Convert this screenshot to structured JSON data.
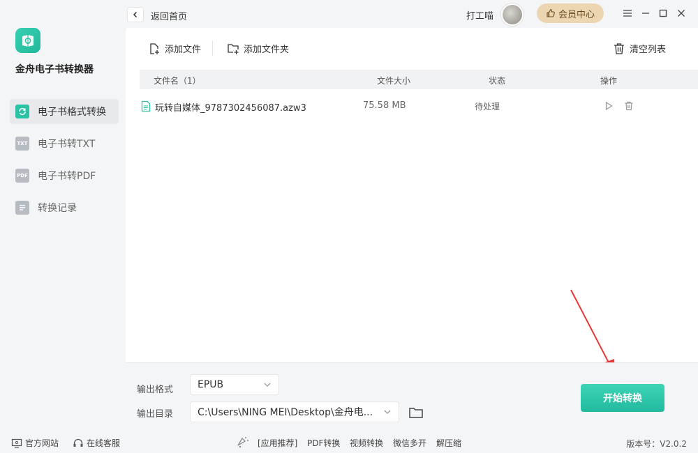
{
  "app": {
    "name": "金舟电子书转换器"
  },
  "sidebar": {
    "items": [
      {
        "label": "电子书格式转换",
        "icon": "refresh-icon",
        "icon_text": "",
        "active": true
      },
      {
        "label": "电子书转TXT",
        "icon": "txt-icon",
        "icon_text": "TXT",
        "active": false
      },
      {
        "label": "电子书转PDF",
        "icon": "pdf-icon",
        "icon_text": "PDF",
        "active": false
      },
      {
        "label": "转换记录",
        "icon": "list-icon",
        "icon_text": "",
        "active": false
      }
    ]
  },
  "topbar": {
    "back_label": "返回首页",
    "username": "打工喵",
    "vip_label": "会员中心"
  },
  "toolbar": {
    "add_file": "添加文件",
    "add_folder": "添加文件夹",
    "clear_list": "清空列表"
  },
  "table": {
    "headers": {
      "name": "文件名（1）",
      "size": "文件大小",
      "status": "状态",
      "actions": "操作"
    },
    "rows": [
      {
        "name": "玩转自媒体_9787302456087.azw3",
        "size": "75.58 MB",
        "status": "待处理"
      }
    ]
  },
  "bottom": {
    "format_label": "输出格式",
    "format_value": "EPUB",
    "dir_label": "输出目录",
    "dir_value": "C:\\Users\\NING MEI\\Desktop\\金舟电...",
    "start_label": "开始转换"
  },
  "footer": {
    "official_site": "官方网站",
    "online_service": "在线客服",
    "recommend": "[应用推荐]",
    "links": [
      "PDF转换",
      "视频转换",
      "微信多开",
      "解压缩"
    ],
    "version": "版本号：V2.0.2"
  },
  "colors": {
    "accent": "#2ec2a5",
    "vip_bg": "#ecd6b2",
    "arrow": "#e53935"
  }
}
